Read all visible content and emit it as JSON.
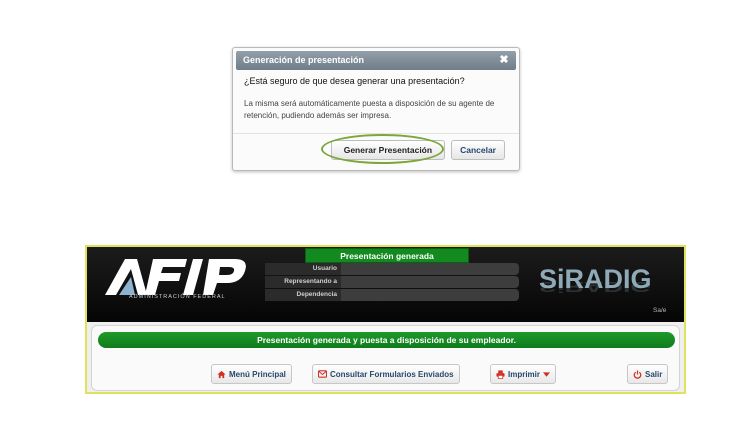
{
  "dialog": {
    "title": "Generación de presentación",
    "close_symbol": "✖",
    "question": "¿Está seguro de que desea generar una presentación?",
    "body": "La misma será automáticamente puesta a disposición de su agente de retención, pudiendo además ser impresa.",
    "confirm_label": "Generar Presentación",
    "cancel_label": "Cancelar"
  },
  "header": {
    "logo_text": "AFIP",
    "logo_subtitle": "ADMINISTRACIÓN FEDERAL",
    "status_tab": "Presentación generada",
    "info_labels": [
      "Usuario",
      "Representando a",
      "Dependencia"
    ],
    "app_name": "SiRADIG",
    "app_name_suffix": "Sa/e"
  },
  "content": {
    "success_message": "Presentación generada y puesta a disposición de su empleador.",
    "buttons": {
      "menu_label": "Menú Principal",
      "consultar_label": "Consultar Formularios Enviados",
      "imprimir_label": "Imprimir",
      "salir_label": "Salir"
    }
  },
  "colors": {
    "accent_green": "#138a1f",
    "highlight_ring": "#7da63a",
    "icon_red": "#d22f25"
  },
  "icons": [
    "close-icon",
    "home-icon",
    "mail-icon",
    "printer-icon",
    "chevron-down-icon",
    "power-icon"
  ]
}
